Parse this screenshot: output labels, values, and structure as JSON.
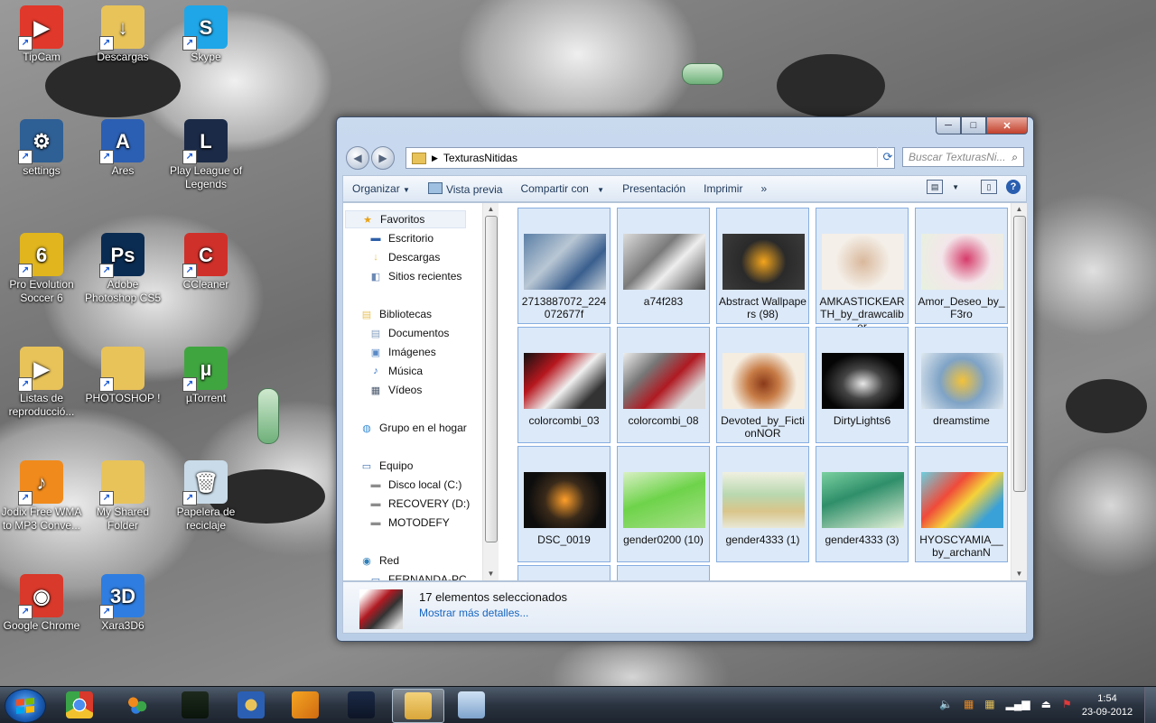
{
  "desktop": {
    "icons": [
      {
        "label": "TipCam",
        "icon": "tipcam-icon",
        "color": "#e0382a",
        "glyph": "▶"
      },
      {
        "label": "Descargas",
        "icon": "folder-download-icon",
        "color": "#e8c35a",
        "glyph": "↓"
      },
      {
        "label": "Skype",
        "icon": "skype-icon",
        "color": "#1ea6e8",
        "glyph": "S"
      },
      {
        "label": "settings",
        "icon": "settings-icon",
        "color": "#2e5f95",
        "glyph": "⚙"
      },
      {
        "label": "Ares",
        "icon": "ares-icon",
        "color": "#2b5fb3",
        "glyph": "A"
      },
      {
        "label": "Play League of Legends",
        "icon": "league-of-legends-icon",
        "color": "#1b2a47",
        "glyph": "L"
      },
      {
        "label": "Pro Evolution Soccer 6",
        "icon": "pes6-icon",
        "color": "#e0b51e",
        "glyph": "6"
      },
      {
        "label": "Adobe Photoshop CS5",
        "icon": "photoshop-icon",
        "color": "#0b2c52",
        "glyph": "Ps"
      },
      {
        "label": "CCleaner",
        "icon": "ccleaner-icon",
        "color": "#d0302a",
        "glyph": "C"
      },
      {
        "label": "Listas de reproducció...",
        "icon": "playlist-folder-icon",
        "color": "#e8c35a",
        "glyph": "▶"
      },
      {
        "label": "PHOTOSHOP !",
        "icon": "folder-icon",
        "color": "#e8c35a",
        "glyph": ""
      },
      {
        "label": "µTorrent",
        "icon": "utorrent-icon",
        "color": "#3fa53f",
        "glyph": "µ"
      },
      {
        "label": "Jodix Free WMA to MP3 Conve...",
        "icon": "jodix-icon",
        "color": "#f08a1c",
        "glyph": "♪"
      },
      {
        "label": "My Shared Folder",
        "icon": "shared-folder-icon",
        "color": "#e8c35a",
        "glyph": ""
      },
      {
        "label": "Papelera de reciclaje",
        "icon": "recycle-bin-icon",
        "color": "#c9dbe8",
        "glyph": "🗑"
      },
      {
        "label": "Google Chrome",
        "icon": "chrome-icon",
        "color": "#d8392b",
        "glyph": "◉"
      },
      {
        "label": "Xara3D6",
        "icon": "xara3d-icon",
        "color": "#2f7de0",
        "glyph": "3D"
      }
    ]
  },
  "window": {
    "minimize": "─",
    "maximize": "□",
    "close": "✕",
    "back": "◀",
    "forward": "▶",
    "address": "TexturasNitidas",
    "search_placeholder": "Buscar TexturasNi...",
    "toolbar": {
      "organize": "Organizar",
      "preview": "Vista previa",
      "share": "Compartir con",
      "presentation": "Presentación",
      "print": "Imprimir",
      "more": "»"
    },
    "nav": [
      {
        "label": "Favoritos",
        "icon": "star-icon",
        "level": 0,
        "glyph": "★",
        "color": "#e8a317"
      },
      {
        "label": "Escritorio",
        "icon": "desktop-icon",
        "level": 1,
        "glyph": "▬",
        "color": "#2d5fa8"
      },
      {
        "label": "Descargas",
        "icon": "downloads-icon",
        "level": 1,
        "glyph": "↓",
        "color": "#e8c35a"
      },
      {
        "label": "Sitios recientes",
        "icon": "recent-places-icon",
        "level": 1,
        "glyph": "◧",
        "color": "#6c8ab5"
      },
      {
        "label": "Bibliotecas",
        "icon": "libraries-icon",
        "level": 0,
        "glyph": "▤",
        "color": "#e8c35a"
      },
      {
        "label": "Documentos",
        "icon": "documents-icon",
        "level": 1,
        "glyph": "▤",
        "color": "#8aa2c2"
      },
      {
        "label": "Imágenes",
        "icon": "pictures-icon",
        "level": 1,
        "glyph": "▣",
        "color": "#5a8ac6"
      },
      {
        "label": "Música",
        "icon": "music-icon",
        "level": 1,
        "glyph": "♪",
        "color": "#2d6fc7"
      },
      {
        "label": "Vídeos",
        "icon": "videos-icon",
        "level": 1,
        "glyph": "▦",
        "color": "#4b5a6e"
      },
      {
        "label": "Grupo en el hogar",
        "icon": "homegroup-icon",
        "level": 0,
        "glyph": "◍",
        "color": "#3a8ed6"
      },
      {
        "label": "Equipo",
        "icon": "computer-icon",
        "level": 0,
        "glyph": "▭",
        "color": "#3d6fb0"
      },
      {
        "label": "Disco local (C:)",
        "icon": "drive-c-icon",
        "level": 1,
        "glyph": "▬",
        "color": "#8c8c8c"
      },
      {
        "label": "RECOVERY (D:)",
        "icon": "drive-d-icon",
        "level": 1,
        "glyph": "▬",
        "color": "#8c8c8c"
      },
      {
        "label": "MOTODEFY",
        "icon": "usb-drive-icon",
        "level": 1,
        "glyph": "▬",
        "color": "#8c8c8c"
      },
      {
        "label": "Red",
        "icon": "network-icon",
        "level": 0,
        "glyph": "◉",
        "color": "#2f7fb8"
      },
      {
        "label": "FERNANDA-PC",
        "icon": "pc-icon",
        "level": 1,
        "glyph": "▭",
        "color": "#3d6fb0"
      }
    ],
    "files": [
      {
        "name": "2713887072_224072677f",
        "bg": "linear-gradient(135deg,#5b7fa6,#b9c7d4 40%,#3a5f8e 70%,#c8d2db)"
      },
      {
        "name": "a74f283",
        "bg": "linear-gradient(135deg,#dcdcdc,#7a7a7a 40%,#eeeeee 60%,#4b4b4b)"
      },
      {
        "name": "Abstract Wallpapers (98)",
        "bg": "radial-gradient(circle at 50% 50%,#f4a51c 0%,#2a2a2a 45%,#3b3b3b 100%)"
      },
      {
        "name": "AMKASTICKEARTH_by_drawcaliber",
        "bg": "radial-gradient(circle at 50% 50%,#d9b89c 0%,#f4efe8 55%)"
      },
      {
        "name": "Amor_Deseo_by_F3ro",
        "bg": "radial-gradient(circle at 55% 45%,#d63b6a 0%,#f3e6ea 45%,#e7f2df 100%)"
      },
      {
        "name": "colorcombi_03",
        "bg": "linear-gradient(135deg,#111 0%,#b7171e 30%,#f0f0f0 55%,#333 80%)"
      },
      {
        "name": "colorcombi_08",
        "bg": "linear-gradient(135deg,#eee 0%,#777 30%,#b01a22 55%,#ddd 80%)"
      },
      {
        "name": "Devoted_by_FictionNOR",
        "bg": "radial-gradient(circle at 50% 55%,#8a3a1a 0%,#c77b45 30%,#f5ede0 65%)"
      },
      {
        "name": "DirtyLights6",
        "bg": "radial-gradient(ellipse at 50% 55%,#e8e8e8 0%,#444 35%,#050505 70%)"
      },
      {
        "name": "dreamstime",
        "bg": "radial-gradient(circle at 50% 50%,#f3c23a 0%,#7fa3c6 45%,#dfe8ef 100%)"
      },
      {
        "name": "DSC_0019",
        "bg": "radial-gradient(circle at 50% 50%,#ff9f2a 0%,#3a2a1a 40%,#0d0d0d 75%)"
      },
      {
        "name": "gender0200 (10)",
        "bg": "linear-gradient(160deg,#d8f0c4 0%,#6ed34a 45%,#a8e08a 100%)"
      },
      {
        "name": "gender4333 (1)",
        "bg": "linear-gradient(180deg,#f0f0e0 0%,#b9d8b0 40%,#d9c58a 70%,#e8e8d8 100%)"
      },
      {
        "name": "gender4333 (3)",
        "bg": "linear-gradient(160deg,#7ad0a0 0%,#2f8f6a 40%,#e3f0d8 100%)"
      },
      {
        "name": "HYOSCYAMIA__by_archanN",
        "bg": "linear-gradient(135deg,#6ad0e0 0%,#f04a3a 35%,#f5d23a 55%,#3aa0d8 80%)"
      },
      {
        "name": "",
        "bg": "linear-gradient(#fbf2f2,#f5e6e6)"
      },
      {
        "name": "",
        "bg": "#e6eef8"
      }
    ],
    "details": {
      "count": "17 elementos seleccionados",
      "more": "Mostrar más detalles..."
    }
  },
  "taskbar": {
    "apps": [
      {
        "icon": "chrome-icon",
        "active": false
      },
      {
        "icon": "messenger-icon",
        "active": false
      },
      {
        "icon": "task-manager-icon",
        "active": false
      },
      {
        "icon": "ares-icon",
        "active": false
      },
      {
        "icon": "media-player-icon",
        "active": false
      },
      {
        "icon": "league-of-legends-icon",
        "active": false
      },
      {
        "icon": "explorer-icon",
        "active": true
      },
      {
        "icon": "calculator-icon",
        "active": false
      }
    ],
    "time": "1:54",
    "date": "23-09-2012"
  }
}
